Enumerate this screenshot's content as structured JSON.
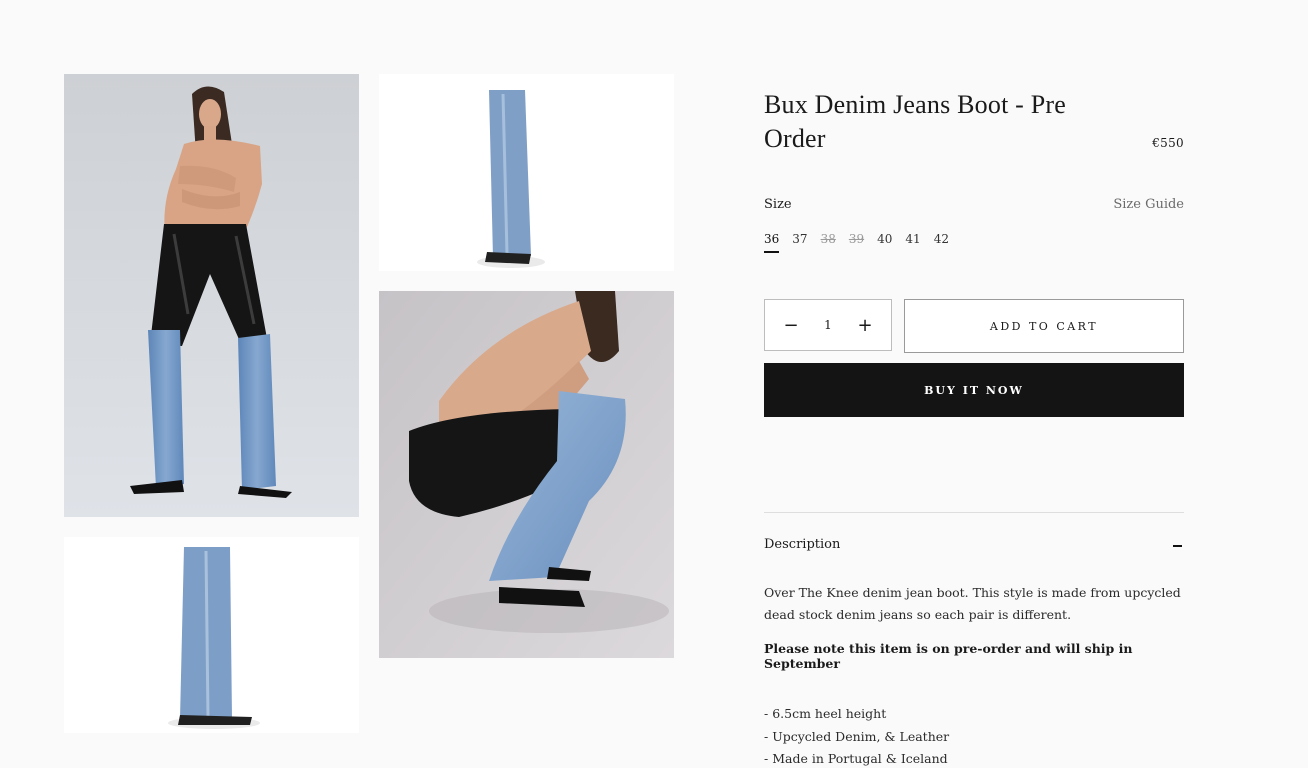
{
  "gallery": {
    "images": [
      {
        "name": "model-standing-photo"
      },
      {
        "name": "boot-side-photo"
      },
      {
        "name": "model-crouching-photo"
      },
      {
        "name": "boot-front-photo"
      }
    ]
  },
  "product": {
    "title": "Bux Denim Jeans Boot - Pre Order",
    "price": "€550"
  },
  "size": {
    "label": "Size",
    "guide_label": "Size Guide",
    "options": [
      {
        "label": "36",
        "state": "selected"
      },
      {
        "label": "37",
        "state": "available"
      },
      {
        "label": "38",
        "state": "soldout"
      },
      {
        "label": "39",
        "state": "soldout"
      },
      {
        "label": "40",
        "state": "available"
      },
      {
        "label": "41",
        "state": "available"
      },
      {
        "label": "42",
        "state": "available"
      }
    ]
  },
  "quantity": {
    "value": "1",
    "decrease_icon": "minus-icon",
    "increase_icon": "plus-icon"
  },
  "actions": {
    "add_to_cart": "ADD TO CART",
    "buy_now": "BUY IT NOW"
  },
  "description": {
    "header": "Description",
    "toggle_icon": "collapse-icon",
    "body": "Over The Knee denim jean boot. This style is made from upcycled dead stock denim jeans so each pair is different.",
    "note": "Please note this item is on pre-order and will ship in September",
    "bullets": [
      "- 6.5cm heel height",
      "- Upcycled Denim, & Leather",
      "- Made in Portugal & Iceland"
    ]
  },
  "colors": {
    "background": "#fafafa",
    "buy_now_bg": "#141414",
    "denim": "#7a9cc4",
    "leather": "#141414"
  }
}
